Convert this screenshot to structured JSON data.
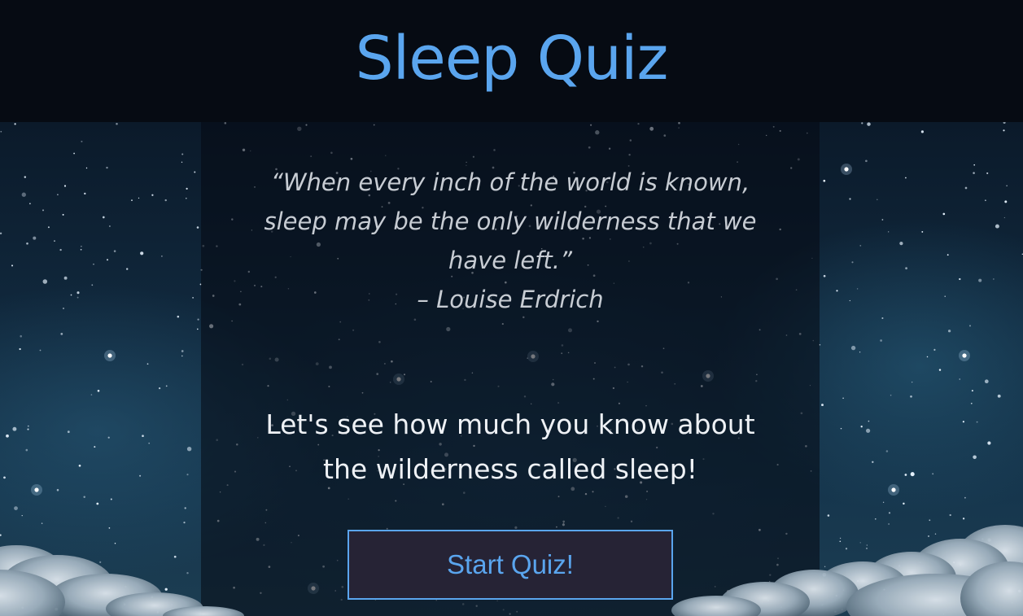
{
  "header": {
    "title": "Sleep Quiz"
  },
  "quote": {
    "lines": [
      "“When every inch of the world is known,",
      "sleep may be the only wilderness that we",
      "have left.”"
    ],
    "author": "– Louise Erdrich"
  },
  "intro": {
    "lines": [
      "Let's see how much you know about",
      "the wilderness called sleep!"
    ]
  },
  "start_button": {
    "label": "Start Quiz!"
  },
  "colors": {
    "accent": "#5aa5ee",
    "header_bg": "#060b13",
    "button_bg": "#262335",
    "quote_text": "#c7ccd3",
    "intro_text": "#eef1f5"
  }
}
